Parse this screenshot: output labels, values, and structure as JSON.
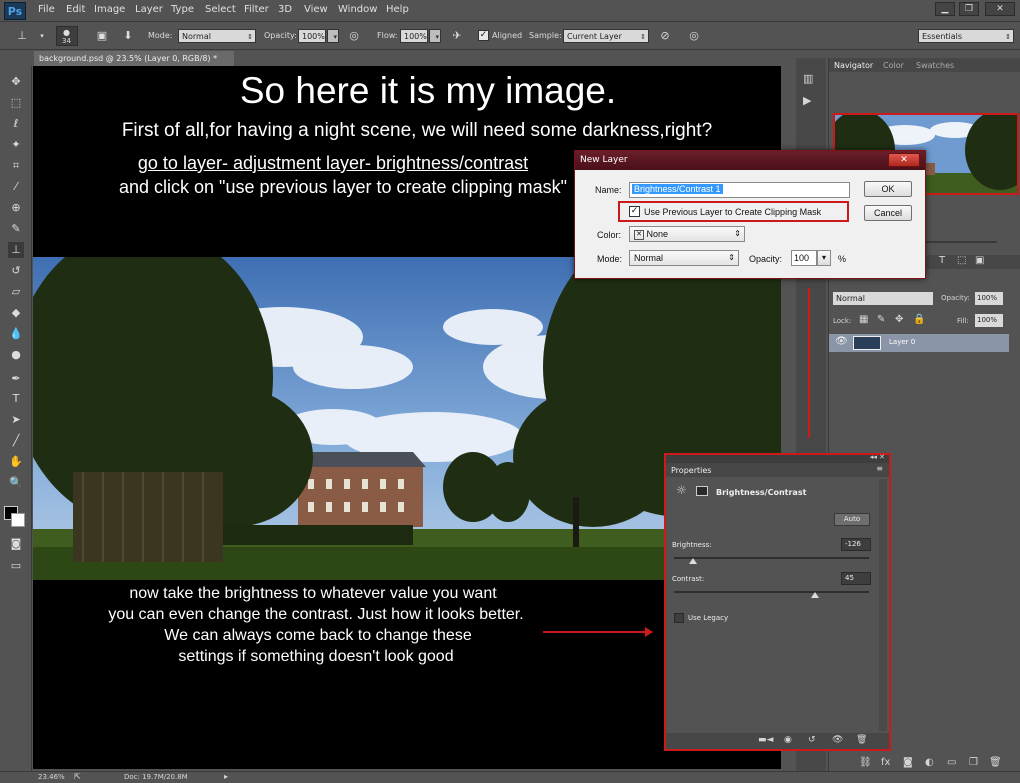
{
  "app": {
    "logo": "Ps",
    "menu": [
      "File",
      "Edit",
      "Image",
      "Layer",
      "Type",
      "Select",
      "Filter",
      "3D",
      "View",
      "Window",
      "Help"
    ],
    "window_controls": [
      "minimize-icon",
      "restore-icon",
      "close-icon"
    ]
  },
  "options_bar": {
    "brush_size": "34",
    "mode_label": "Mode:",
    "mode_value": "Normal",
    "opacity_label": "Opacity:",
    "opacity_value": "100%",
    "flow_label": "Flow:",
    "flow_value": "100%",
    "aligned_label": "Aligned",
    "sample_label": "Sample:",
    "sample_value": "Current Layer",
    "workspace": "Essentials"
  },
  "document": {
    "tab_title": "background.psd @ 23.5% (Layer 0, RGB/8) *"
  },
  "canvas_text": {
    "headline": "So here it is my image.",
    "line1": "First of all,for having a  night scene, we will need some darkness,right?",
    "line2": "go to layer- adjustment layer- brightness/contrast",
    "line3": "and click on \"use previous layer to create clipping mask\"",
    "bottom1": "now take the brightness to  whatever value you want",
    "bottom2": "you can even change the contrast. Just how it looks better.",
    "bottom3": "We can always come back to change these",
    "bottom4": "settings if something doesn't look good"
  },
  "new_layer_dialog": {
    "title": "New Layer",
    "name_label": "Name:",
    "name_value": "Brightness/Contrast 1",
    "clip_label": "Use Previous Layer to Create Clipping Mask",
    "color_label": "Color:",
    "color_value": "None",
    "mode_label": "Mode:",
    "mode_value": "Normal",
    "opacity_label": "Opacity:",
    "opacity_value": "100",
    "percent": "%",
    "ok": "OK",
    "cancel": "Cancel"
  },
  "navigator": {
    "tabs": [
      "Navigator",
      "Color",
      "Swatches"
    ]
  },
  "layers": {
    "blend_mode": "Normal",
    "opacity_label": "Opacity:",
    "opacity_value": "100%",
    "lock_label": "Lock:",
    "fill_label": "Fill:",
    "fill_value": "100%",
    "layer_name": "Layer 0"
  },
  "properties": {
    "tab": "Properties",
    "title": "Brightness/Contrast",
    "auto": "Auto",
    "brightness_label": "Brightness:",
    "brightness_value": "-126",
    "contrast_label": "Contrast:",
    "contrast_value": "45",
    "legacy_label": "Use Legacy"
  },
  "status": {
    "zoom": "23.46%",
    "doc": "Doc: 19.7M/20.8M"
  },
  "colors": {
    "highlight": "#cc1a1a",
    "ui_bg": "#535353"
  }
}
